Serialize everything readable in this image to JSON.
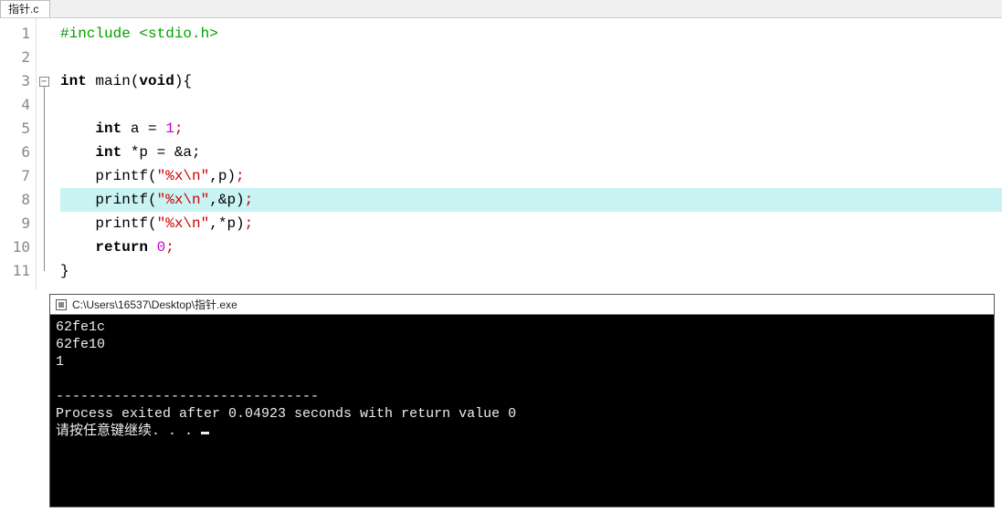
{
  "tab": {
    "label": "指针.c"
  },
  "code": {
    "line1": {
      "pp": "#include <stdio.h>"
    },
    "line2": "",
    "line3": {
      "kw1": "int",
      "fn": " main(",
      "kw2": "void",
      "after": "){"
    },
    "line4": "",
    "line5": {
      "indent": "    ",
      "kw": "int",
      "rest1": " a ",
      "op": "=",
      "sp": " ",
      "num": "1",
      "semi": ";"
    },
    "line6": {
      "indent": "    ",
      "kw": "int",
      "rest": " *p = &a;"
    },
    "line7": {
      "indent": "    ",
      "fn": "printf(",
      "str": "\"%x\\n\"",
      "args": ",p)",
      "semi": ";"
    },
    "line8": {
      "indent": "    ",
      "fn": "printf(",
      "str": "\"%x\\n\"",
      "args": ",&p)",
      "semi": ";"
    },
    "line9": {
      "indent": "    ",
      "fn": "printf(",
      "str": "\"%x\\n\"",
      "args": ",*p)",
      "semi": ";"
    },
    "line10": {
      "indent": "    ",
      "kw": "return",
      "sp": " ",
      "num": "0",
      "semi": ";"
    },
    "line11": {
      "brace": "}"
    }
  },
  "lineNumbers": [
    "1",
    "2",
    "3",
    "4",
    "5",
    "6",
    "7",
    "8",
    "9",
    "10",
    "11"
  ],
  "foldSymbol": "−",
  "console": {
    "title": "C:\\Users\\16537\\Desktop\\指针.exe",
    "out1": "62fe1c",
    "out2": "62fe10",
    "out3": "1",
    "blank": "",
    "sep": "--------------------------------",
    "exit": "Process exited after 0.04923 seconds with return value 0",
    "prompt": "请按任意键继续. . . "
  }
}
